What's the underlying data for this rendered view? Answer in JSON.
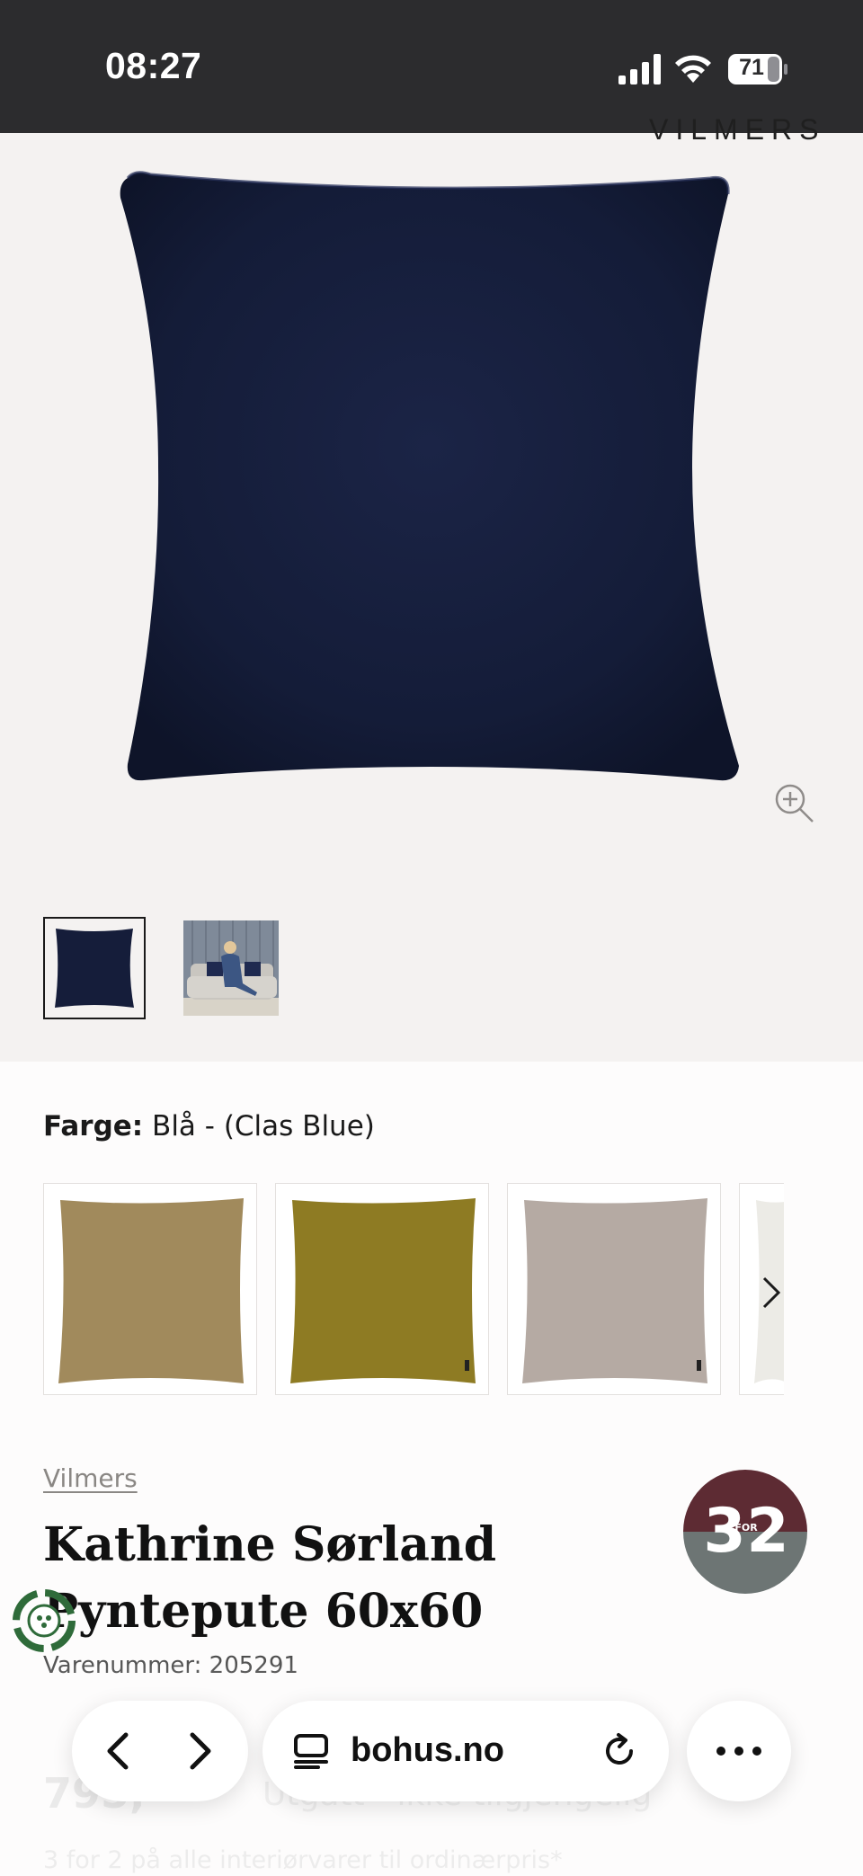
{
  "status_bar": {
    "time": "08:27",
    "battery": "71",
    "icons": [
      "signal-icon",
      "wifi-icon",
      "battery-icon"
    ]
  },
  "gallery": {
    "brand_watermark": "VILMERS",
    "main_image": "navy-velvet-cushion",
    "zoom_icon": "zoom-in-icon",
    "thumbnails": [
      "navy-cushion-thumbnail",
      "lifestyle-sofa-thumbnail"
    ]
  },
  "color_selector": {
    "label": "Farge:",
    "value": "Blå - (Clas Blue)",
    "swatch_colors": [
      "#a18a5c",
      "#8e7b23",
      "#b5aaa3",
      "#ecebe6"
    ],
    "next_icon": "chevron-right-icon"
  },
  "product": {
    "brand": "Vilmers",
    "title_line1": "Kathrine Sørland",
    "title_line2": "Pyntepute 60x60",
    "sku": "Varenummer: 205291",
    "promo_badge": {
      "left": "3",
      "for": "FOR",
      "right": "2",
      "colors": [
        "#5d2b33",
        "#6d7574"
      ]
    },
    "price": "795,-",
    "stock": "Utgått - ikke tilgjengelig",
    "promo_text": "3 for 2 på alle interiørvarer til ordinærpris*"
  },
  "browser_bar": {
    "url": "bohus.no",
    "icons": [
      "back-icon",
      "forward-icon",
      "tabs-icon",
      "reload-icon",
      "more-icon"
    ]
  },
  "colors": {
    "status_bar_bg": "#2c2c2e",
    "gallery_bg": "#f4f2f1",
    "cushion": "#151d3a"
  }
}
